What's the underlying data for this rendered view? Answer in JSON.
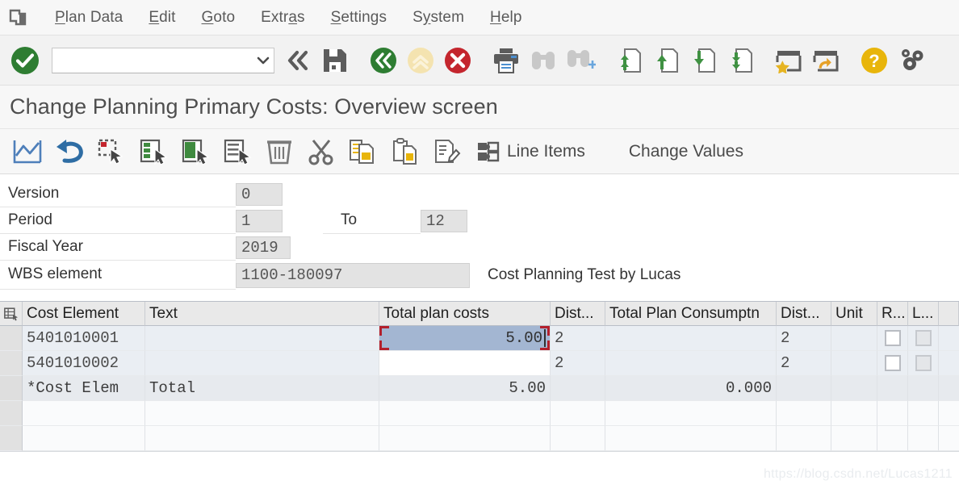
{
  "window": {
    "system_icon": "sap-system-menu-icon"
  },
  "menubar": {
    "items": [
      {
        "label": "Plan Data",
        "accel": "P",
        "name": "menu-plan-data"
      },
      {
        "label": "Edit",
        "accel": "E",
        "name": "menu-edit"
      },
      {
        "label": "Goto",
        "accel": "G",
        "name": "menu-goto"
      },
      {
        "label": "Extras",
        "accel": "a",
        "name": "menu-extras"
      },
      {
        "label": "Settings",
        "accel": "S",
        "name": "menu-settings"
      },
      {
        "label": "System",
        "accel": "y",
        "name": "menu-system"
      },
      {
        "label": "Help",
        "accel": "H",
        "name": "menu-help"
      }
    ]
  },
  "system_toolbar": {
    "enter_label": "enter-icon",
    "command_field": {
      "value": "",
      "placeholder": "",
      "dropdown_icon": "chevron-down-icon"
    },
    "buttons": [
      {
        "name": "back-chevrons-icon",
        "title": "Back"
      },
      {
        "name": "save-icon",
        "title": "Save"
      },
      {
        "name": "green-back-icon",
        "title": "Back"
      },
      {
        "name": "yellow-exit-up-icon",
        "title": "Exit"
      },
      {
        "name": "red-cancel-icon",
        "title": "Cancel"
      },
      {
        "name": "print-icon",
        "title": "Print"
      },
      {
        "name": "find-icon",
        "title": "Find"
      },
      {
        "name": "find-next-icon",
        "title": "Find Next"
      },
      {
        "name": "first-page-icon",
        "title": "First Page"
      },
      {
        "name": "previous-page-icon",
        "title": "Previous Page"
      },
      {
        "name": "next-page-icon",
        "title": "Next Page"
      },
      {
        "name": "last-page-icon",
        "title": "Last Page"
      },
      {
        "name": "favorites-icon",
        "title": "Create Favorite"
      },
      {
        "name": "shortcut-icon",
        "title": "Create Shortcut"
      },
      {
        "name": "help-icon",
        "title": "Help"
      },
      {
        "name": "customize-local-layout-icon",
        "title": "Customize Local Layout"
      }
    ]
  },
  "page": {
    "title": "Change Planning Primary Costs: Overview screen"
  },
  "app_toolbar": {
    "icon_buttons": [
      {
        "name": "graph-display-icon",
        "title": "Period screen"
      },
      {
        "name": "undo-icon",
        "title": "Undo"
      },
      {
        "name": "select-block-icon",
        "title": "Select block"
      },
      {
        "name": "select-column-icon",
        "title": "Select column"
      },
      {
        "name": "select-filled-column-icon",
        "title": "Select column"
      },
      {
        "name": "select-row-icon",
        "title": "Select row"
      },
      {
        "name": "delete-icon",
        "title": "Delete"
      },
      {
        "name": "cut-icon",
        "title": "Cut"
      },
      {
        "name": "copy-icon",
        "title": "Copy"
      },
      {
        "name": "paste-icon",
        "title": "Paste"
      },
      {
        "name": "edit-text-icon",
        "title": "Change text"
      }
    ],
    "line_items": {
      "label": "Line Items",
      "icon": "line-items-puzzle-icon"
    },
    "change_values": {
      "label": "Change Values"
    }
  },
  "form": {
    "version": {
      "label": "Version",
      "value": "0"
    },
    "period": {
      "label": "Period",
      "value": "1"
    },
    "period_to": {
      "label": "To",
      "value": "12"
    },
    "fiscal_year": {
      "label": "Fiscal Year",
      "value": "2019"
    },
    "wbs_element": {
      "label": "WBS element",
      "value": "1100-180097",
      "description": "Cost Planning Test by Lucas"
    }
  },
  "grid": {
    "row_selector_icon": "table-settings-icon",
    "columns": [
      {
        "key": "cost_element",
        "label": "Cost Element"
      },
      {
        "key": "text",
        "label": "Text"
      },
      {
        "key": "total_plan_costs",
        "label": "Total plan costs"
      },
      {
        "key": "dist_key_costs",
        "label": "Dist..."
      },
      {
        "key": "total_plan_consumption",
        "label": "Total Plan Consumptn"
      },
      {
        "key": "dist_key_consumption",
        "label": "Dist..."
      },
      {
        "key": "unit",
        "label": "Unit"
      },
      {
        "key": "r_flag",
        "label": "R..."
      },
      {
        "key": "l_flag",
        "label": "L..."
      }
    ],
    "rows": [
      {
        "type": "data",
        "cost_element": "5401010001",
        "text": "",
        "total_plan_costs": "5.00",
        "focused": true,
        "dist_key_costs": "2",
        "total_plan_consumption": "",
        "dist_key_consumption": "2",
        "unit": "",
        "r_flag": false,
        "l_flag": false
      },
      {
        "type": "data",
        "cost_element": "5401010002",
        "text": "",
        "total_plan_costs": "",
        "focused": false,
        "dist_key_costs": "2",
        "total_plan_consumption": "",
        "dist_key_consumption": "2",
        "unit": "",
        "r_flag": false,
        "l_flag": false
      },
      {
        "type": "total",
        "cost_element": "*Cost Elem",
        "text": "Total",
        "total_plan_costs": "5.00",
        "focused": false,
        "dist_key_costs": "",
        "total_plan_consumption": "0.000",
        "dist_key_consumption": "",
        "unit": "",
        "r_flag": null,
        "l_flag": null
      },
      {
        "type": "empty",
        "cost_element": "",
        "text": "",
        "total_plan_costs": "",
        "dist_key_costs": "",
        "total_plan_consumption": "",
        "dist_key_consumption": "",
        "unit": "",
        "r_flag": null,
        "l_flag": null,
        "focused": false
      },
      {
        "type": "empty",
        "cost_element": "",
        "text": "",
        "total_plan_costs": "",
        "dist_key_costs": "",
        "total_plan_consumption": "",
        "dist_key_consumption": "",
        "unit": "",
        "r_flag": null,
        "l_flag": null,
        "focused": false
      }
    ]
  },
  "watermark": "https://blog.csdn.net/Lucas1211",
  "colors": {
    "accent_green": "#2b7a2b",
    "accent_red": "#c4262e",
    "accent_yellow": "#f0c43c",
    "focus_cell": "#a3b6d2",
    "focus_bracket": "#b3202c",
    "toolbar_bg": "#f2f2f2",
    "grid_header_bg": "#e9e9e9"
  }
}
